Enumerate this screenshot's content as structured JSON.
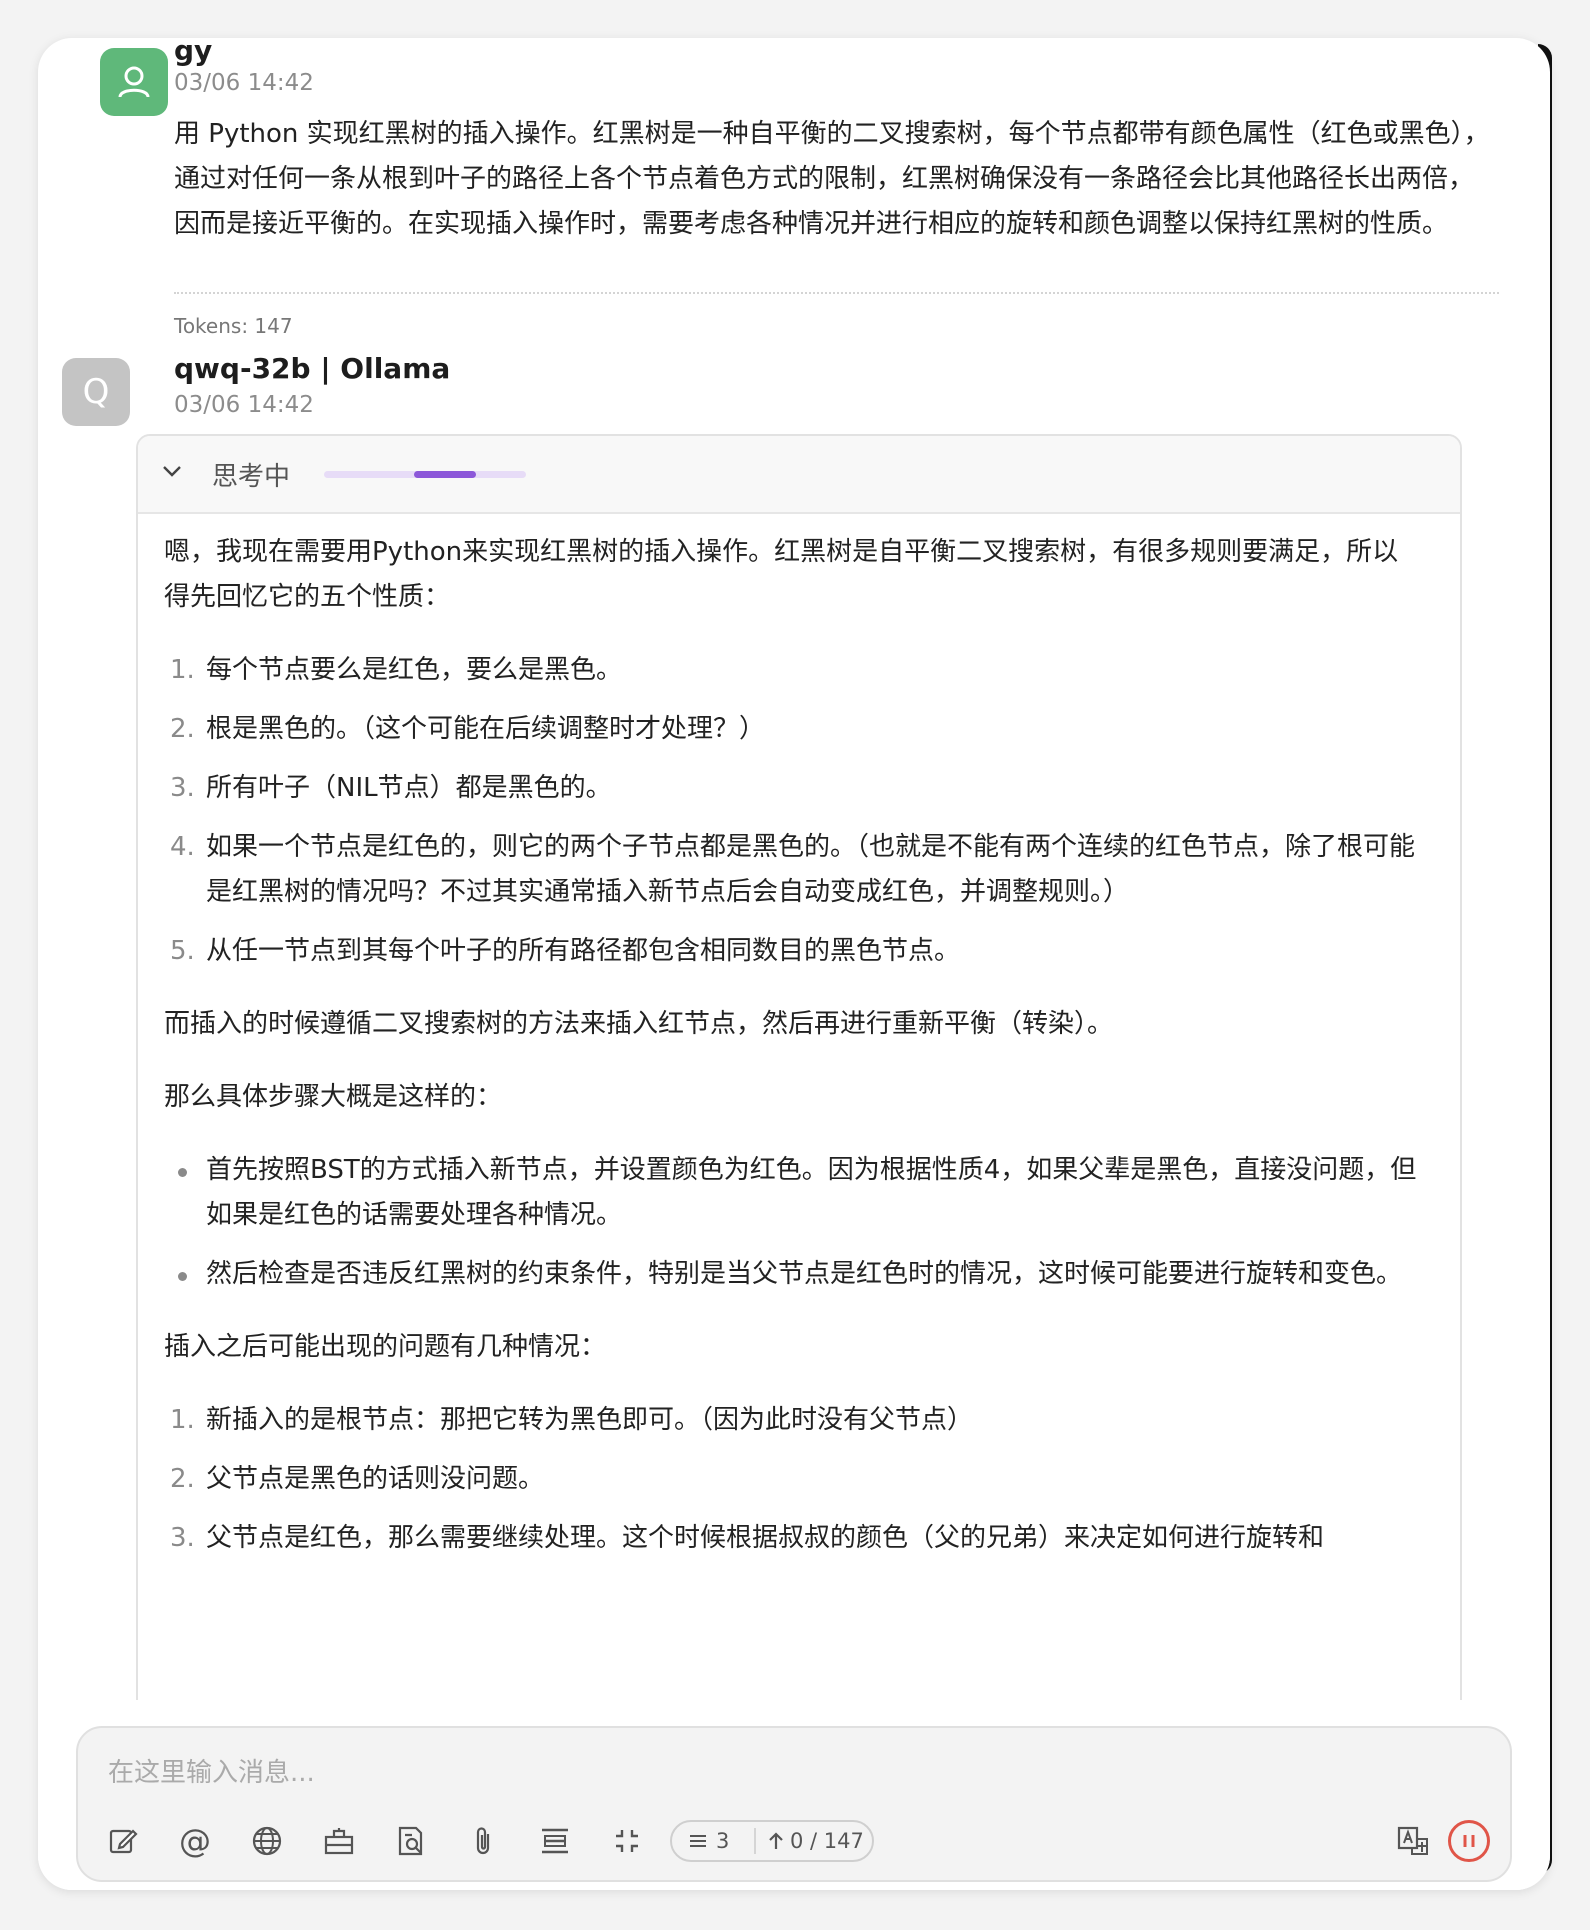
{
  "user_message": {
    "name": "gy",
    "timestamp": "03/06 14:42",
    "text": "用 Python 实现红黑树的插入操作。红黑树是一种自平衡的二叉搜索树，每个节点都带有颜色属性（红色或黑色），通过对任何一条从根到叶子的路径上各个节点着色方式的限制，红黑树确保没有一条路径会比其他路径长出两倍，因而是接近平衡的。在实现插入操作时，需要考虑各种情况并进行相应的旋转和颜色调整以保持红黑树的性质。",
    "tokens": "Tokens: 147"
  },
  "bot_message": {
    "avatar_letter": "Q",
    "name": "qwq-32b | Ollama",
    "timestamp": "03/06 14:42",
    "thinking": {
      "label": "思考中",
      "progress": 0.75,
      "intro": "嗯，我现在需要用Python来实现红黑树的插入操作。红黑树是自平衡二叉搜索树，有很多规则要满足，所以得先回忆它的五个性质：",
      "properties": [
        {
          "num": "1.",
          "text": "每个节点要么是红色，要么是黑色。"
        },
        {
          "num": "2.",
          "text": "根是黑色的。（这个可能在后续调整时才处理？）"
        },
        {
          "num": "3.",
          "text": "所有叶子（NIL节点）都是黑色的。"
        },
        {
          "num": "4.",
          "text": "如果一个节点是红色的，则它的两个子节点都是黑色的。（也就是不能有两个连续的红色节点，除了根可能是红黑树的情况吗？不过其实通常插入新节点后会自动变成红色，并调整规则。）"
        },
        {
          "num": "5.",
          "text": "从任一节点到其每个叶子的所有路径都包含相同数目的黑色节点。"
        }
      ],
      "para2": "而插入的时候遵循二叉搜索树的方法来插入红节点，然后再进行重新平衡（转染）。",
      "para3": "那么具体步骤大概是这样的：",
      "steps": [
        "首先按照BST的方式插入新节点，并设置颜色为红色。因为根据性质4，如果父辈是黑色，直接没问题，但如果是红色的话需要处理各种情况。",
        "然后检查是否违反红黑树的约束条件，特别是当父节点是红色时的情况，这时候可能要进行旋转和变色。"
      ],
      "para4": "插入之后可能出现的问题有几种情况：",
      "cases": [
        {
          "num": "1.",
          "text": "新插入的是根节点：那把它转为黑色即可。（因为此时没有父节点）"
        },
        {
          "num": "2.",
          "text": "父节点是黑色的话则没问题。"
        },
        {
          "num": "3.",
          "text": "父节点是红色，那么需要继续处理。这个时候根据叔叔的颜色（父的兄弟）来决定如何进行旋转和"
        }
      ]
    }
  },
  "input": {
    "placeholder": "在这里输入消息...",
    "context_count": "3",
    "token_counter": "0 / 147"
  },
  "icons": [
    "edit-icon",
    "at-icon",
    "globe-icon",
    "knowledge-base-icon",
    "web-search-icon",
    "attachment-icon",
    "collapse-icon",
    "fullscreen-icon",
    "translate-icon",
    "stop-icon"
  ],
  "colors": {
    "user_avatar": "#5fb87a",
    "bot_avatar": "#c4c4c4",
    "progress": "#8c57d9",
    "stop": "#e05548"
  }
}
